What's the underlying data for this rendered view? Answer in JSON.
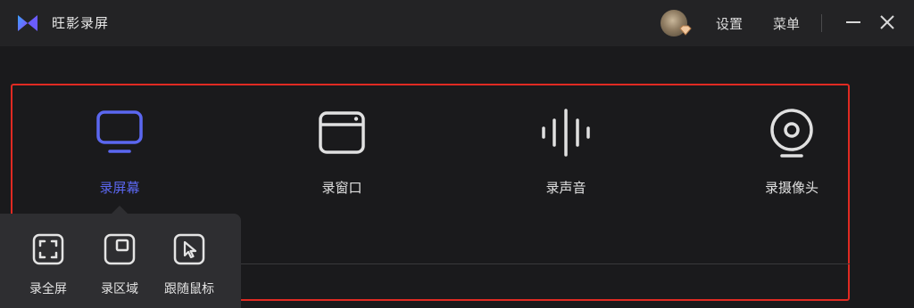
{
  "app": {
    "title": "旺影录屏",
    "logo_icon": "play-logo-icon"
  },
  "titlebar": {
    "settings_label": "设置",
    "menu_label": "菜单",
    "minimize_icon": "minimize-icon",
    "close_icon": "close-icon"
  },
  "modes": [
    {
      "label": "录屏幕",
      "icon": "monitor-icon",
      "active": true
    },
    {
      "label": "录窗口",
      "icon": "window-icon",
      "active": false
    },
    {
      "label": "录声音",
      "icon": "audio-wave-icon",
      "active": false
    },
    {
      "label": "录摄像头",
      "icon": "webcam-icon",
      "active": false
    }
  ],
  "submodes": [
    {
      "label": "录全屏",
      "icon": "fullscreen-icon"
    },
    {
      "label": "录区域",
      "icon": "region-icon"
    },
    {
      "label": "跟随鼠标",
      "icon": "cursor-follow-icon"
    }
  ],
  "colors": {
    "accent": "#5b67f0",
    "highlight_border": "#e02a22",
    "background": "#1a1a1c"
  }
}
